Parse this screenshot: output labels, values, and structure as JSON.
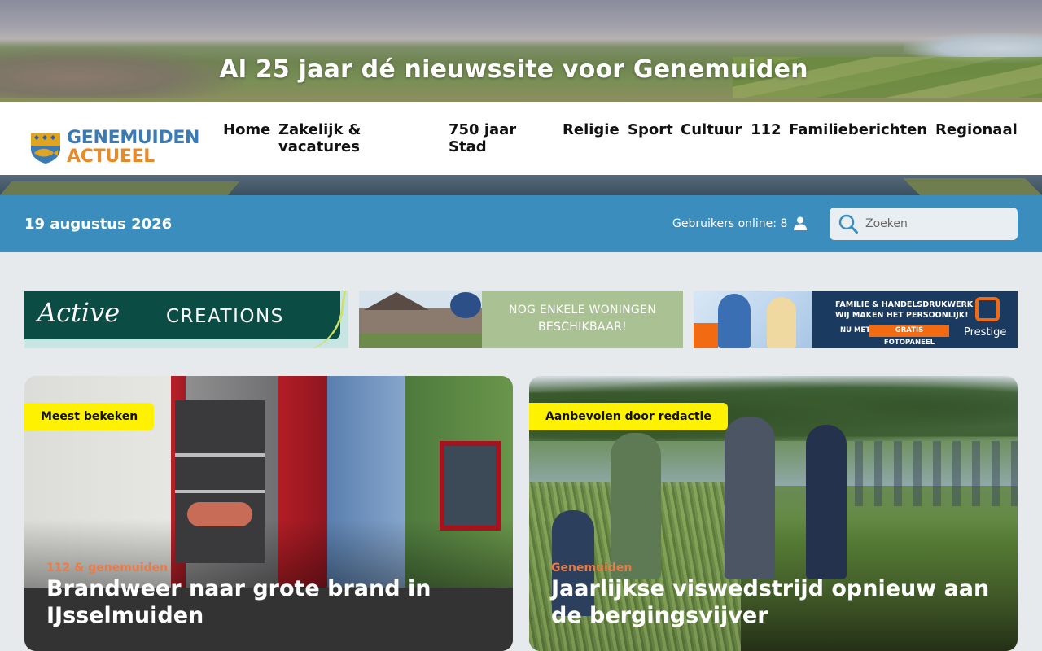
{
  "hero": {
    "tagline": "Al 25 jaar dé nieuwssite voor Genemuiden"
  },
  "logo": {
    "line1": "GENEMUIDEN",
    "line2": "ACTUEEL",
    "icon": "fish-shield-icon",
    "colors": {
      "blue": "#3a7bb6",
      "orange": "#e88a2a"
    }
  },
  "nav": [
    {
      "label": "Home"
    },
    {
      "label": "Zakelijk & vacatures"
    },
    {
      "label": "750 jaar Stad"
    },
    {
      "label": "Religie"
    },
    {
      "label": "Sport"
    },
    {
      "label": "Cultuur"
    },
    {
      "label": "112"
    },
    {
      "label": "Familieberichten"
    },
    {
      "label": "Regionaal"
    }
  ],
  "infobar": {
    "date": "19 augustus 2026",
    "online_label": "Gebruikers online: 8",
    "icon": "user-icon",
    "accent": "#3b8dbd"
  },
  "search": {
    "placeholder": "Zoeken",
    "icon": "search-icon"
  },
  "banners": [
    {
      "script": "Active",
      "caps": "CREATIONS"
    },
    {
      "text_line1": "NOG ENKELE WONINGEN",
      "text_line2": "BESCHIKBAAR!"
    },
    {
      "line1": "FAMILIE & HANDELSDRUKWERK",
      "line2": "WIJ MAKEN HET PERSOONLIJK!",
      "line3": "NU MET",
      "pill": "GRATIS FOTOPANEEL",
      "brand": "Prestige"
    }
  ],
  "articles": [
    {
      "badge": "Meest bekeken",
      "category": "112 & genemuiden",
      "title": "Brandweer naar grote brand in IJsselmuiden"
    },
    {
      "badge": "Aanbevolen door redactie",
      "category": "Genemuiden",
      "title": "Jaarlijkse viswedstrijd opnieuw aan de bergingsvijver"
    }
  ],
  "colors": {
    "badge": "#fff200",
    "category": "#ea7a46",
    "background": "#e6eaed"
  }
}
